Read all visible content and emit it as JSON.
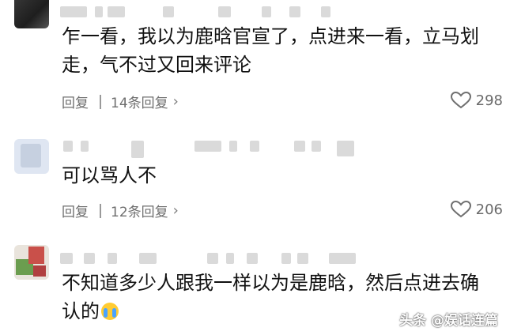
{
  "comments": [
    {
      "text": "乍一看，我以为鹿晗官宣了，点进来一看，立马划走，气不过又回来评论",
      "reply_label": "回复",
      "replies": "14条回复",
      "likes": "298"
    },
    {
      "text": "可以骂人不",
      "reply_label": "回复",
      "replies": "12条回复",
      "likes": "206"
    },
    {
      "text": "不知道多少人跟我一样以为是鹿晗，然后点进去确认的",
      "emoji": "loudly-crying-face"
    }
  ],
  "watermark": "头条 @娱话连篇",
  "colors": {
    "text": "#111111",
    "meta": "#6f6f6f",
    "icon": "#707070"
  }
}
